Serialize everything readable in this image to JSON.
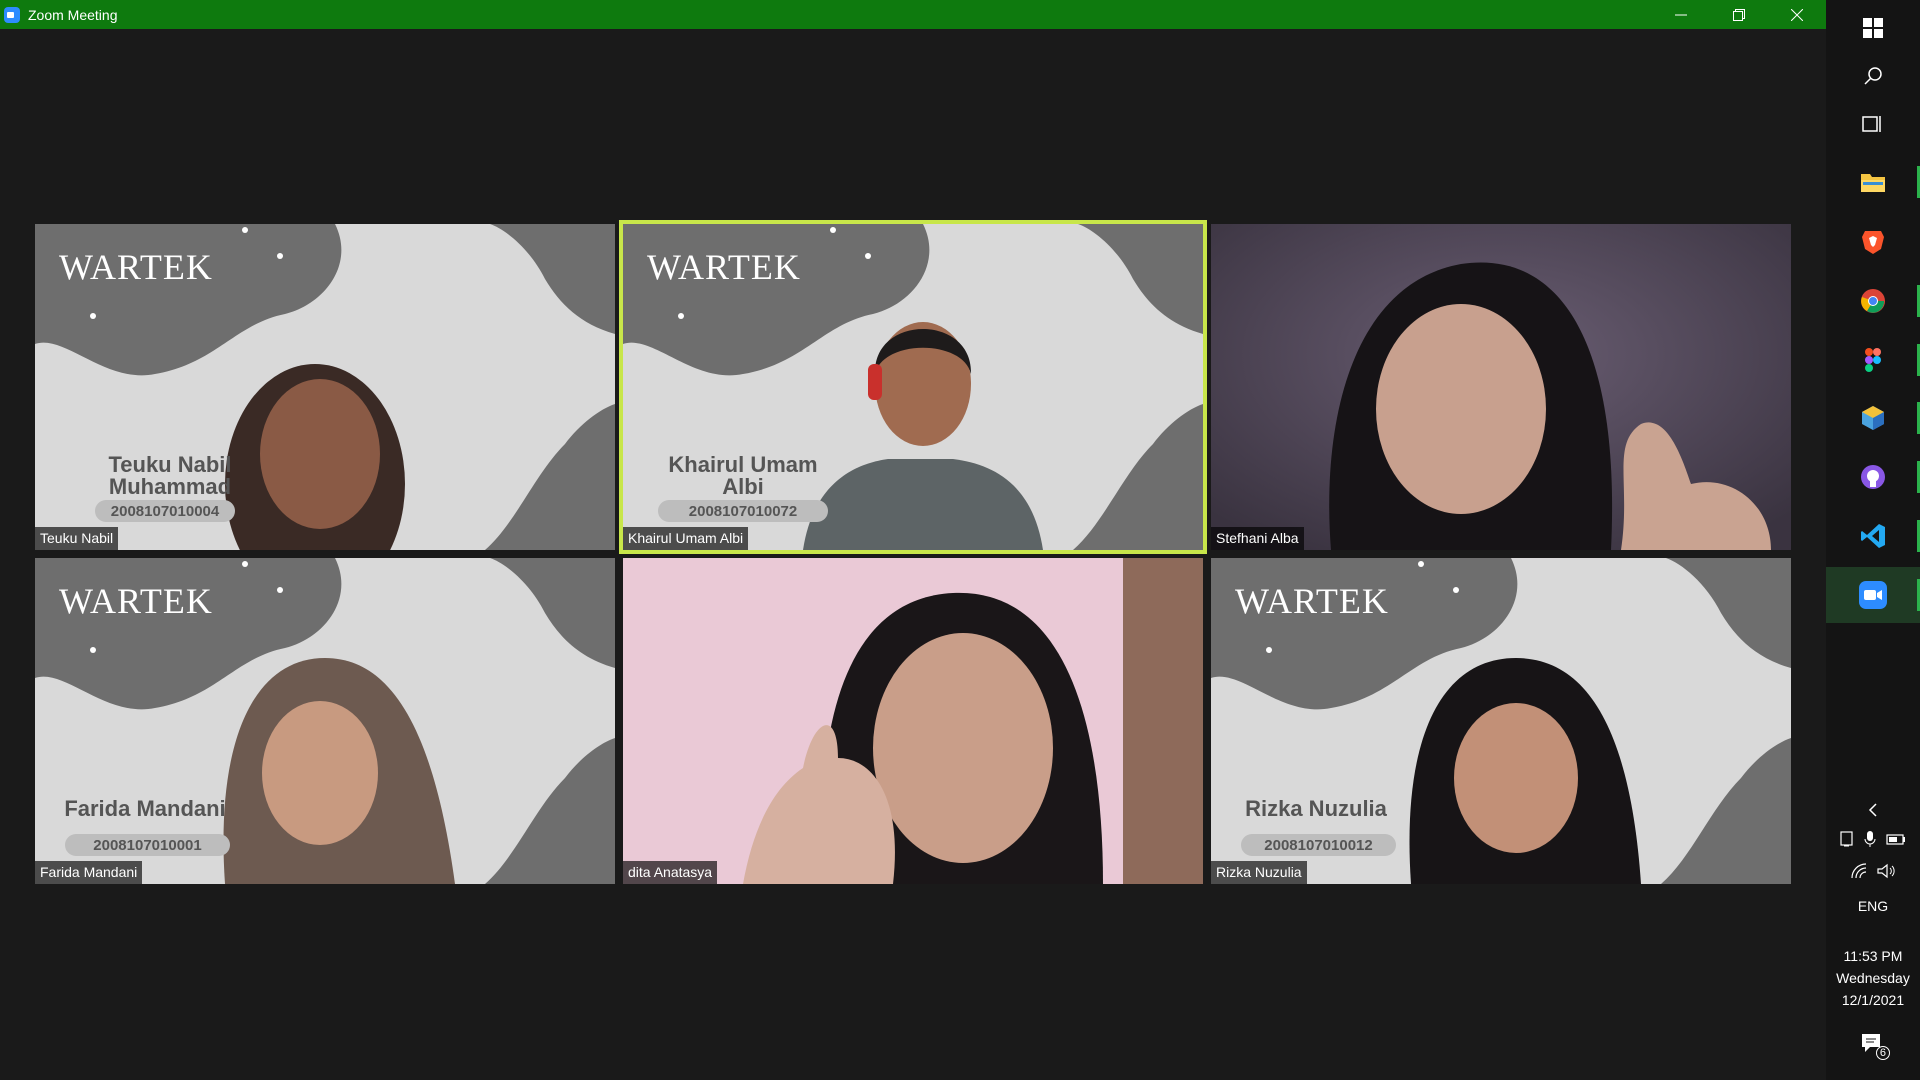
{
  "window": {
    "title": "Zoom Meeting"
  },
  "participants": [
    {
      "label": "Teuku Nabil",
      "bg_name": [
        "Teuku Nabil",
        "Muhammad Dhuha"
      ],
      "bg_id": "2008107010004",
      "logo": "WARTEK",
      "active": false,
      "video": "virtual-background"
    },
    {
      "label": "Khairul Umam Albi",
      "bg_name": [
        "Khairul Umam",
        "Albi"
      ],
      "bg_id": "2008107010072",
      "logo": "WARTEK",
      "active": true,
      "video": "virtual-background"
    },
    {
      "label": "Stefhani Alba",
      "video": "camera"
    },
    {
      "label": "Farida Mandani",
      "bg_name": [
        "Farida Mandani"
      ],
      "bg_id": "2008107010001",
      "logo": "WARTEK",
      "active": false,
      "video": "virtual-background"
    },
    {
      "label": "dita Anatasya",
      "video": "camera"
    },
    {
      "label": "Rizka Nuzulia",
      "bg_name": [
        "Rizka Nuzulia"
      ],
      "bg_id": "2008107010012",
      "logo": "WARTEK",
      "active": false,
      "video": "virtual-background"
    }
  ],
  "taskbar": {
    "apps": [
      "windows-start",
      "search",
      "task-view",
      "file-explorer",
      "brave",
      "chrome",
      "figma",
      "virtualbox",
      "github-desktop",
      "vscode",
      "zoom"
    ],
    "language": "ENG",
    "time": "11:53 PM",
    "day": "Wednesday",
    "date": "12/1/2021",
    "notifications": "6"
  },
  "colors": {
    "titlebar": "#0e7a0e",
    "active_speaker": "#c8e64a",
    "meeting_bg": "#1a1a1a",
    "taskbar_bg": "#141414"
  }
}
